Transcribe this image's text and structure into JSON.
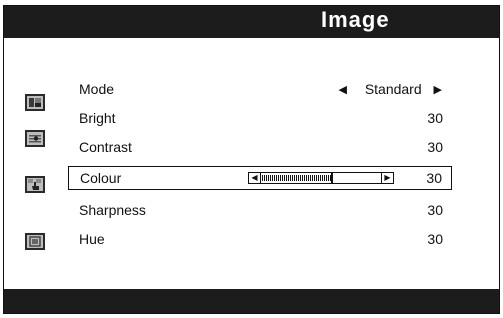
{
  "menu": {
    "title": "Image",
    "settings": [
      {
        "label": "Mode",
        "value": "Standard"
      },
      {
        "label": "Bright",
        "value": "30"
      },
      {
        "label": "Contrast",
        "value": "30"
      },
      {
        "label": "Colour",
        "value": "30"
      },
      {
        "label": "Sharpness",
        "value": "30"
      },
      {
        "label": "Hue",
        "value": "30"
      }
    ],
    "colour_slider": {
      "level": 0.6
    },
    "icons": [
      "picture-icon",
      "image-adjust-icon",
      "setup-hand-icon",
      "option-icon"
    ],
    "colors": {
      "bar": "#1c1c1c",
      "text": "#111111",
      "icon_fill": "#bdbdbd"
    }
  }
}
